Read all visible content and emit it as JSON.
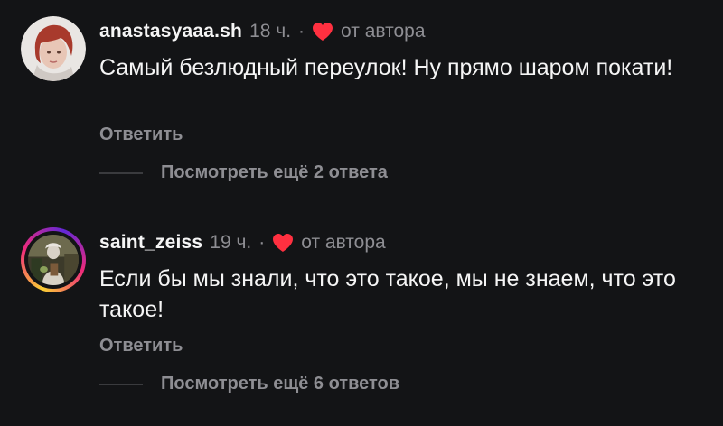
{
  "comments": [
    {
      "username": "anastasyaaa.sh",
      "time": "18 ч.",
      "separator": "·",
      "author_note": "от автора",
      "text": "Самый безлюдный переулок! Ну прямо шаром покати!",
      "reply_label": "Ответить",
      "more_replies_label": "Посмотреть ещё 2 ответа",
      "heart_icon": "heart-icon",
      "heart_color": "#ff3040"
    },
    {
      "username": "saint_zeiss",
      "time": "19 ч.",
      "separator": "·",
      "author_note": "от автора",
      "text": "Если бы мы знали, что это такое, мы не знаем, что это такое!",
      "reply_label": "Ответить",
      "more_replies_label": "Посмотреть ещё 6 ответов",
      "heart_icon": "heart-icon",
      "heart_color": "#ff3040"
    }
  ],
  "colors": {
    "background": "#131416",
    "primary_text": "#f5f5f5",
    "secondary_text": "#8e8e93",
    "like_red": "#ff3040"
  }
}
